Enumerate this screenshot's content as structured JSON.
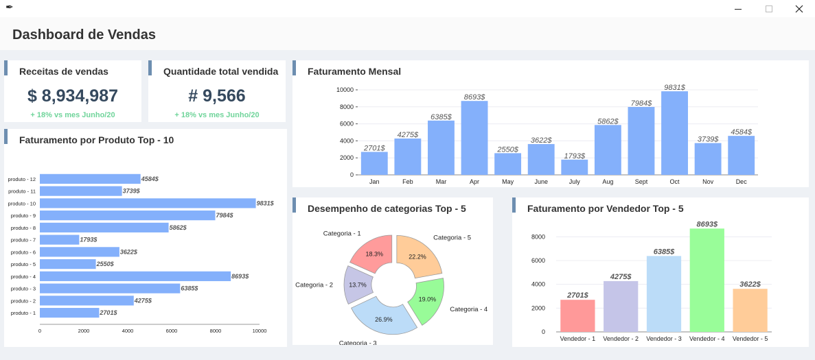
{
  "window": {
    "app_icon": "feather-icon",
    "minimize_icon": "minimize-icon",
    "maximize_icon": "maximize-icon",
    "close_icon": "close-icon"
  },
  "header": {
    "title": "Dashboard de Vendas"
  },
  "kpis": [
    {
      "title": "Receitas de vendas",
      "value": "$ 8,934,987",
      "delta": "+ 18% vs mes Junho/20"
    },
    {
      "title": "Quantidade total vendida",
      "value": "# 9,566",
      "delta": "+ 18% vs mes Junho/20"
    }
  ],
  "cards": {
    "monthly": "Faturamento Mensal",
    "products": "Faturamento por Produto Top - 10",
    "categories": "Desempenho de categorias Top - 5",
    "sellers": "Faturamento por Vendedor Top - 5"
  },
  "colors": {
    "accent": "#6d8eb0",
    "bar": "#84b0fb",
    "kpi_value": "#35495e",
    "kpi_delta": "#6fd49a"
  },
  "chart_data": [
    {
      "type": "bar",
      "id": "monthly",
      "title": "Faturamento Mensal",
      "categories": [
        "Jan",
        "Feb",
        "Mar",
        "Apr",
        "May",
        "June",
        "July",
        "Aug",
        "Sept",
        "Oct",
        "Nov",
        "Dec"
      ],
      "values": [
        2701,
        4275,
        6385,
        8693,
        2550,
        3622,
        1793,
        5862,
        7984,
        9831,
        3739,
        4584
      ],
      "labels": [
        "2701$",
        "4275$",
        "6385$",
        "8693$",
        "2550$",
        "3622$",
        "1793$",
        "5862$",
        "7984$",
        "9831$",
        "3739$",
        "4584$"
      ],
      "ylim": [
        0,
        10000
      ],
      "yticks": [
        0,
        2000,
        4000,
        6000,
        8000,
        10000
      ],
      "grid": true
    },
    {
      "type": "bar",
      "orientation": "horizontal",
      "id": "products",
      "title": "Faturamento por Produto Top - 10",
      "categories": [
        "produto - 12",
        "produto - 11",
        "produto - 10",
        "produto - 9",
        "produto - 8",
        "produto - 7",
        "produto - 6",
        "produto - 5",
        "produto - 4",
        "produto - 3",
        "produto - 2",
        "produto - 1"
      ],
      "values": [
        4584,
        3739,
        9831,
        7984,
        5862,
        1793,
        3622,
        2550,
        8693,
        6385,
        4275,
        2701
      ],
      "labels": [
        "4584$",
        "3739$",
        "9831$",
        "7984$",
        "5862$",
        "1793$",
        "3622$",
        "2550$",
        "8693$",
        "6385$",
        "4275$",
        "2701$"
      ],
      "xlim": [
        0,
        10000
      ],
      "xticks": [
        0,
        2000,
        4000,
        6000,
        8000,
        10000
      ]
    },
    {
      "type": "pie",
      "id": "categories",
      "title": "Desempenho de categorias Top - 5",
      "categories": [
        "Categoria - 1",
        "Categoria - 2",
        "Categoria - 3",
        "Categoria - 4",
        "Categoria - 5"
      ],
      "values": [
        18.3,
        13.7,
        26.9,
        19.0,
        22.2
      ],
      "labels": [
        "18.3%",
        "13.7%",
        "26.9%",
        "19.0%",
        "22.2%"
      ],
      "colors": [
        "#ff9b9b",
        "#c6c6e6",
        "#bcdcf8",
        "#98fb98",
        "#ffcc99"
      ]
    },
    {
      "type": "bar",
      "id": "sellers",
      "title": "Faturamento por Vendedor Top - 5",
      "categories": [
        "Vendedor - 1",
        "Vendedor - 2",
        "Vendedor - 3",
        "Vendedor - 4",
        "Vendedor - 5"
      ],
      "values": [
        2701,
        4275,
        6385,
        8693,
        3622
      ],
      "labels": [
        "2701$",
        "4275$",
        "6385$",
        "8693$",
        "3622$"
      ],
      "colors": [
        "#ff9999",
        "#c5c5e8",
        "#bbdcf8",
        "#99fd99",
        "#ffcc99"
      ],
      "ylim": [
        0,
        9000
      ],
      "yticks": [
        0,
        2000,
        4000,
        6000,
        8000
      ],
      "grid": true
    }
  ]
}
